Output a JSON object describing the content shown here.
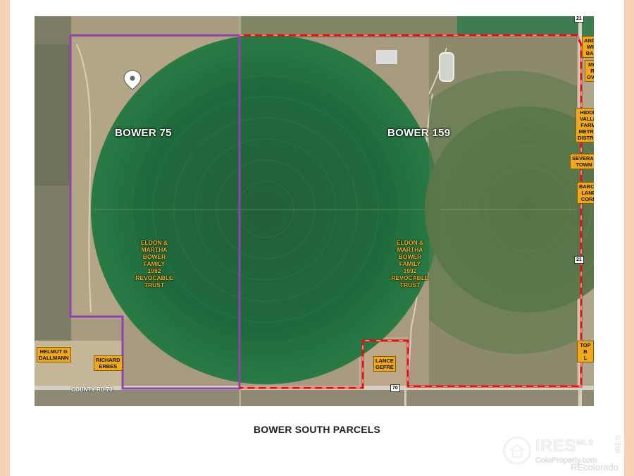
{
  "parcels": [
    {
      "name": "BOWER 75",
      "owner": "ELDON &\nMARTHA\nBOWER\nFAMILY\n1992\nREVOCABLE\nTRUST"
    },
    {
      "name": "BOWER 159",
      "owner": "ELDON &\nMARTHA\nBOWER\nFAMILY\n1992\nREVOCABLE\nTRUST"
    }
  ],
  "neighbors": [
    {
      "label": "HELMUT G\nDALLMANN"
    },
    {
      "label": "RICHARD\nERBES"
    },
    {
      "label": "LANCE\nGEFRE"
    },
    {
      "label": "ANDR\nWIL\nBAR"
    },
    {
      "label": "MC\nR\nOVE"
    },
    {
      "label": "HIDDE\nVALLE\nFARM\nMETRO\nDISTRIC"
    },
    {
      "label": "SEVERANC\nTOWN O"
    },
    {
      "label": "BABCO\nLAND\nCORP"
    },
    {
      "label": "TOP B\nL"
    }
  ],
  "roads": {
    "county_rd": "COUNTY RD 70",
    "shield_70": "70",
    "shield_21_top": "21",
    "shield_21_mid": "21"
  },
  "caption": "BOWER SOUTH PARCELS",
  "watermark": {
    "brand": "IRES",
    "mls": "MLS",
    "site": "ColoProperty.com",
    "vertical": "IRES",
    "recolorado": "REcolorado"
  },
  "colors": {
    "bower75_boundary": "#8e44ad",
    "bower159_boundary": "#e01010",
    "owner_text": "#f3b21a",
    "neighbor_tag": "#f0a81d"
  }
}
